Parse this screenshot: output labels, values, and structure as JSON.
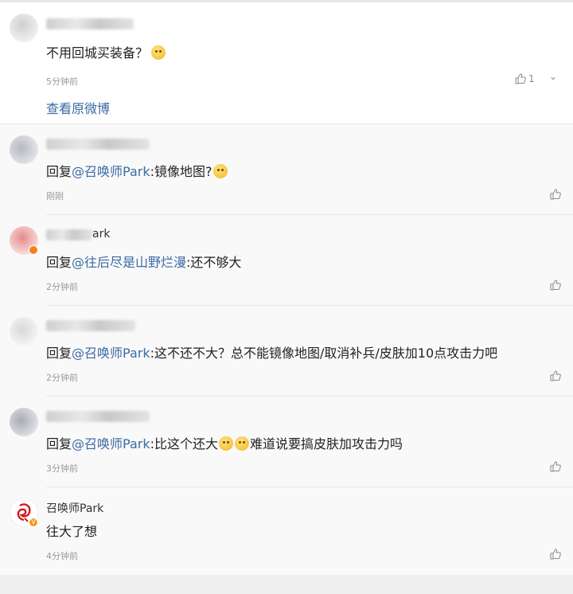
{
  "post": {
    "text": "不用回城买装备？",
    "emoji": "doge-emoji",
    "time": "5分钟前",
    "like_count": "1",
    "view_original": "查看原微博"
  },
  "comments": [
    {
      "name": "",
      "reply_prefix": "回复",
      "mention": "@召唤师Park",
      "body": ":镜像地图?",
      "emojis": [
        "thinking-emoji"
      ],
      "time": "刚刚"
    },
    {
      "name": "ark",
      "reply_prefix": "回复",
      "mention": "@往后尽是山野烂漫",
      "body": ":还不够大",
      "time": "2分钟前"
    },
    {
      "name": "",
      "reply_prefix": "回复",
      "mention": "@召唤师Park",
      "body": ":这不还不大？总不能镜像地图/取消补兵/皮肤加10点攻击力吧",
      "time": "2分钟前"
    },
    {
      "name": "",
      "reply_prefix": "回复",
      "mention": "@召唤师Park",
      "body": ":比这个还大",
      "body_after": "难道说要搞皮肤加攻击力吗",
      "emojis": [
        "laugh-emoji",
        "shy-emoji"
      ],
      "time": "3分钟前"
    },
    {
      "name": "召唤师Park",
      "body": "往大了想",
      "time": "4分钟前",
      "badge": "V"
    }
  ],
  "colors": {
    "mention": "#3b6aa3",
    "time": "#999999",
    "badge": "#f39a1e"
  }
}
